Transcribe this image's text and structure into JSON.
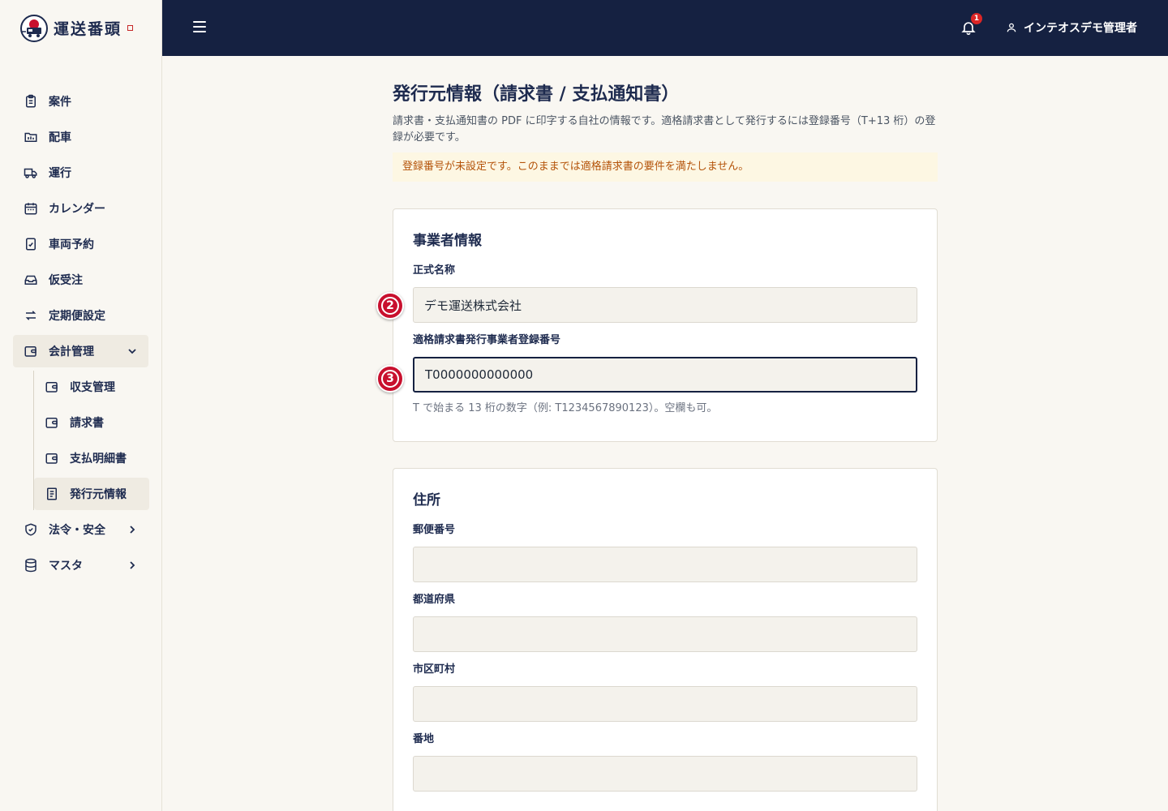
{
  "brand": {
    "name": "運送番頭"
  },
  "topbar": {
    "notification_count": "1",
    "user_name": "インテオスデモ管理者"
  },
  "sidebar": {
    "items": [
      {
        "label": "案件",
        "icon": "clipboard-icon"
      },
      {
        "label": "配車",
        "icon": "folder-chart-icon"
      },
      {
        "label": "運行",
        "icon": "truck-icon"
      },
      {
        "label": "カレンダー",
        "icon": "calendar-icon"
      },
      {
        "label": "車両予約",
        "icon": "clipboard-check-icon"
      },
      {
        "label": "仮受注",
        "icon": "inbox-icon"
      },
      {
        "label": "定期便設定",
        "icon": "repeat-icon"
      },
      {
        "label": "会計管理",
        "icon": "wallet-icon"
      },
      {
        "label": "法令・安全",
        "icon": "shield-icon"
      },
      {
        "label": "マスタ",
        "icon": "database-icon"
      }
    ],
    "accounting_sub": [
      {
        "label": "収支管理",
        "icon": "wallet-icon"
      },
      {
        "label": "請求書",
        "icon": "wallet-icon"
      },
      {
        "label": "支払明細書",
        "icon": "wallet-icon"
      },
      {
        "label": "発行元情報",
        "icon": "document-icon"
      }
    ]
  },
  "page": {
    "title": "発行元情報（請求書 / 支払通知書）",
    "description": "請求書・支払通知書の PDF に印字する自社の情報です。適格請求書として発行するには登録番号（T+13 桁）の登録が必要です。",
    "warning": "登録番号が未設定です。このままでは適格請求書の要件を満たしません。"
  },
  "business_card": {
    "title": "事業者情報",
    "official_name_label": "正式名称",
    "official_name_value": "デモ運送株式会社",
    "registration_label": "適格請求書発行事業者登録番号",
    "registration_value": "T0000000000000",
    "registration_help": "T で始まる 13 桁の数字（例: T1234567890123）。空欄も可。"
  },
  "address_card": {
    "title": "住所",
    "postal_label": "郵便番号",
    "postal_value": "",
    "prefecture_label": "都道府県",
    "prefecture_value": "",
    "city_label": "市区町村",
    "city_value": "",
    "street_label": "番地",
    "street_value": ""
  },
  "markers": {
    "step2": "2",
    "step3": "3"
  }
}
